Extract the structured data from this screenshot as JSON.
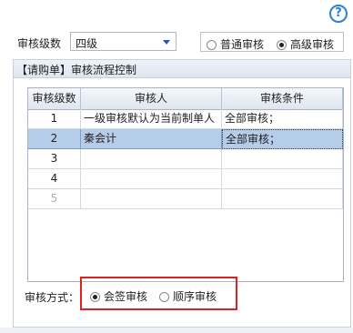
{
  "help": {
    "icon": "help-icon",
    "glyph": "?"
  },
  "level": {
    "label": "审核级数",
    "value": "四级"
  },
  "mode": {
    "options": [
      {
        "label": "普通审核",
        "selected": false
      },
      {
        "label": "高级审核",
        "selected": true
      }
    ]
  },
  "panel": {
    "title": "【请购单】审核流程控制"
  },
  "grid": {
    "columns": [
      "审核级数",
      "审核人",
      "审核条件"
    ],
    "rows": [
      {
        "level": "1",
        "reviewer": "一级审核默认为当前制单人",
        "condition": "全部审核；"
      },
      {
        "level": "2",
        "reviewer": "秦会计",
        "condition": "全部审核；"
      },
      {
        "level": "3",
        "reviewer": "",
        "condition": ""
      },
      {
        "level": "4",
        "reviewer": "",
        "condition": ""
      },
      {
        "level": "5",
        "reviewer": "",
        "condition": ""
      }
    ]
  },
  "sign": {
    "label": "审核方式：",
    "options": [
      {
        "label": "会签审核",
        "selected": true
      },
      {
        "label": "顺序审核",
        "selected": false
      }
    ]
  },
  "colors": {
    "accent": "#2d7fd0",
    "highlight": "#e02020",
    "selected_row": "#b5cde9"
  }
}
